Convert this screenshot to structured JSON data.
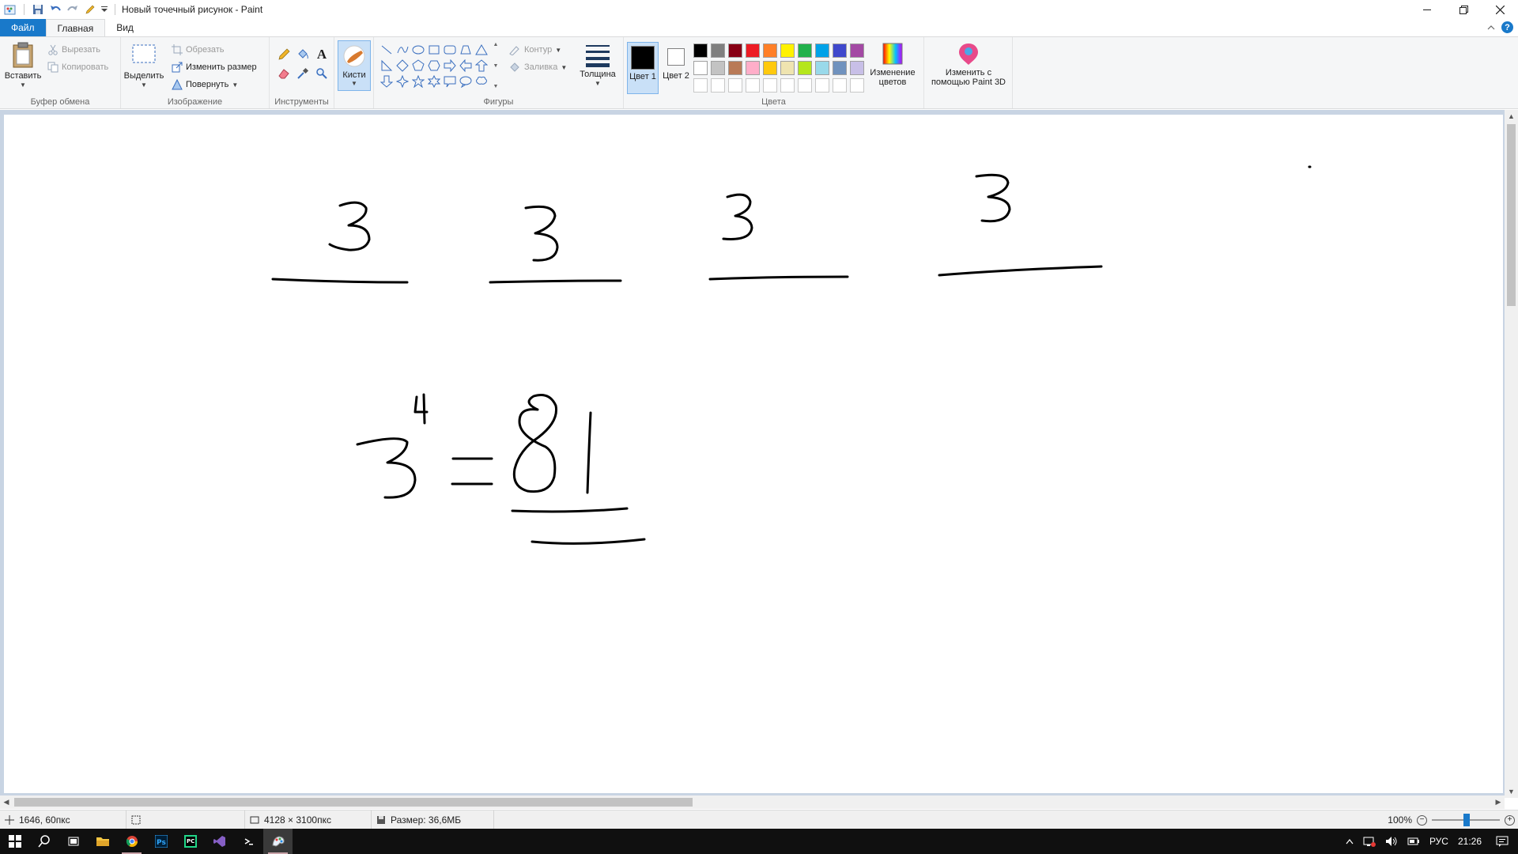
{
  "window": {
    "title": "Новый точечный рисунок - Paint",
    "controls": [
      "minimize",
      "restore",
      "close"
    ]
  },
  "tabs": {
    "file": "Файл",
    "home": "Главная",
    "view": "Вид"
  },
  "ribbon": {
    "clipboard": {
      "label": "Буфер обмена",
      "paste": "Вставить",
      "cut": "Вырезать",
      "copy": "Копировать"
    },
    "image": {
      "label": "Изображение",
      "select": "Выделить",
      "crop": "Обрезать",
      "resize": "Изменить размер",
      "rotate": "Повернуть"
    },
    "tools": {
      "label": "Инструменты",
      "brushes": "Кисти"
    },
    "shapes": {
      "label": "Фигуры",
      "outline": "Контур",
      "fill": "Заливка"
    },
    "size": {
      "label": "Толщина"
    },
    "colors": {
      "label": "Цвета",
      "color1": "Цвет 1",
      "color2": "Цвет 2",
      "edit_colors": "Изменение цветов",
      "paint3d": "Изменить с помощью Paint 3D",
      "color1_value": "#000000",
      "color2_value": "#ffffff",
      "palette_row1": [
        "#000000",
        "#7f7f7f",
        "#880015",
        "#ed1c24",
        "#ff7f27",
        "#fff200",
        "#22b14c",
        "#00a2e8",
        "#3f48cc",
        "#a349a4"
      ],
      "palette_row2": [
        "#ffffff",
        "#c3c3c3",
        "#b97a57",
        "#ffaec9",
        "#ffc90e",
        "#efe4b0",
        "#b5e61d",
        "#99d9ea",
        "#7092be",
        "#c8bfe7"
      ],
      "palette_row3": [
        "#ffffff",
        "#ffffff",
        "#ffffff",
        "#ffffff",
        "#ffffff",
        "#ffffff",
        "#ffffff",
        "#ffffff",
        "#ffffff",
        "#ffffff"
      ]
    }
  },
  "status": {
    "cursor_pos": "1646, 60пкс",
    "image_size": "4128 × 3100пкс",
    "file_size": "Размер: 36,6МБ",
    "zoom": "100%"
  },
  "taskbar": {
    "apps": [
      "start-icon",
      "search-icon",
      "task-view-icon",
      "file-explorer-icon",
      "chrome-icon",
      "photoshop-icon",
      "pycharm-icon",
      "visual-studio-icon",
      "vscode-icon",
      "paint-icon"
    ],
    "language": "РУС",
    "time": "21:26"
  }
}
